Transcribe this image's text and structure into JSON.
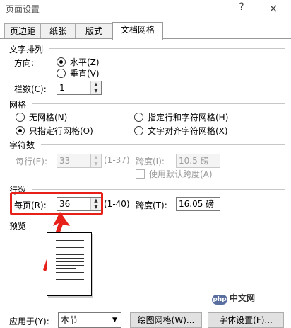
{
  "window": {
    "title": "页面设置",
    "help_glyph": "?",
    "close_glyph": "×"
  },
  "tabs": [
    {
      "label": "页边距",
      "active": false
    },
    {
      "label": "纸张",
      "active": false
    },
    {
      "label": "版式",
      "active": false
    },
    {
      "label": "文档网格",
      "active": true
    }
  ],
  "text_direction": {
    "title": "文字排列",
    "direction_label": "方向:",
    "options": [
      {
        "label": "水平(Z)",
        "selected": true
      },
      {
        "label": "垂直(V)",
        "selected": false
      }
    ],
    "columns_label": "栏数(C):",
    "columns_value": "1"
  },
  "grid": {
    "title": "网格",
    "options": [
      {
        "label": "无网格(N)",
        "selected": false
      },
      {
        "label": "指定行和字符网格(H)",
        "selected": false
      },
      {
        "label": "只指定行网格(O)",
        "selected": true
      },
      {
        "label": "文字对齐字符网格(X)",
        "selected": false
      }
    ]
  },
  "chars": {
    "title": "字符数",
    "per_line_label": "每行(E):",
    "per_line_value": "33",
    "per_line_range": "(1-37)",
    "pitch_label": "跨度(I):",
    "pitch_value": "10.5 磅",
    "default_pitch_label": "使用默认跨度(A)",
    "default_pitch_checked": false
  },
  "lines": {
    "title": "行数",
    "per_page_label": "每页(R):",
    "per_page_value": "36",
    "per_page_range": "(1-40)",
    "pitch_label": "跨度(T):",
    "pitch_value": "16.05 磅"
  },
  "preview": {
    "title": "预览"
  },
  "footer": {
    "apply_label": "应用于(Y):",
    "apply_value": "本节",
    "draw_grid_button": "绘图网格(W)...",
    "font_settings_button": "字体设置(F)..."
  },
  "watermark": {
    "icon": "php",
    "text": "中文网"
  },
  "colors": {
    "highlight": "#e8201a",
    "arrow": "#e8201a"
  }
}
